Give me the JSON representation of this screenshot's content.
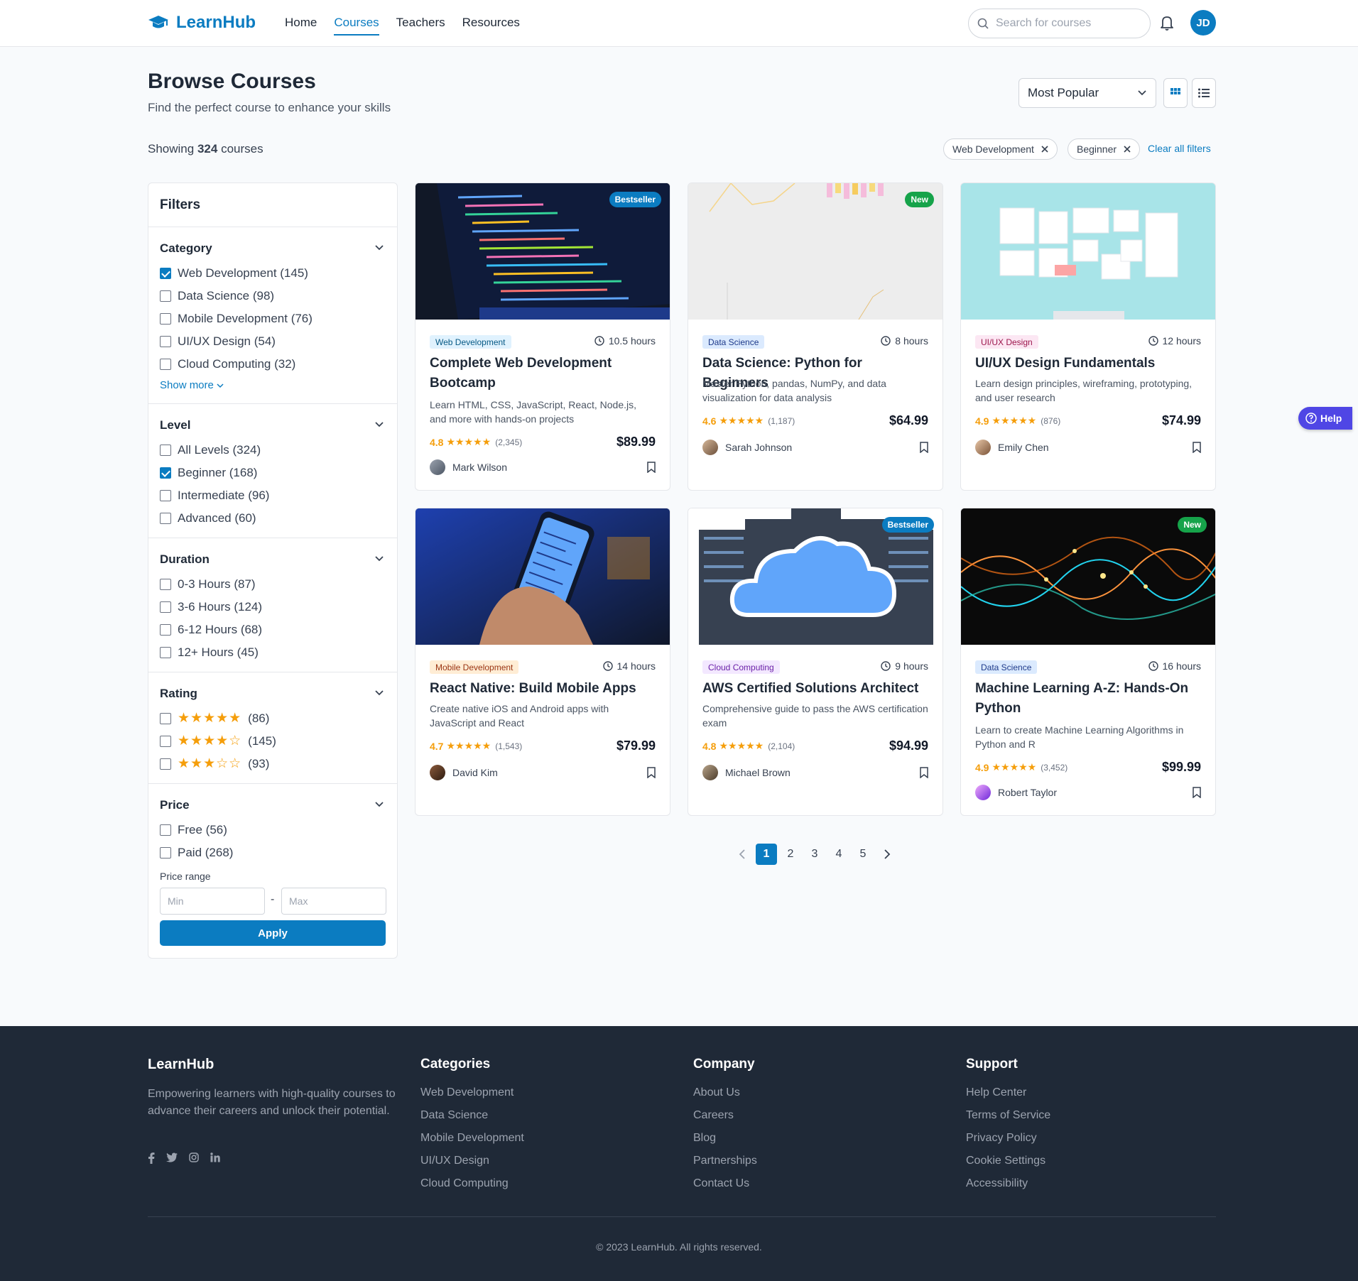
{
  "header": {
    "brand": "LearnHub",
    "nav": [
      "Home",
      "Courses",
      "Teachers",
      "Resources"
    ],
    "active_nav": "Courses",
    "search_placeholder": "Search for courses",
    "user_initials": "JD"
  },
  "page": {
    "title": "Browse Courses",
    "subtitle": "Find the perfect course to enhance your skills",
    "sort_value": "Most Popular",
    "showing_prefix": "Showing",
    "showing_count": "324",
    "showing_suffix": "courses",
    "active_filters": [
      "Web Development",
      "Beginner"
    ],
    "clear_filters": "Clear all filters"
  },
  "filters": {
    "title": "Filters",
    "category": {
      "title": "Category",
      "options": [
        {
          "label": "Web Development (145)",
          "checked": true
        },
        {
          "label": "Data Science (98)",
          "checked": false
        },
        {
          "label": "Mobile Development (76)",
          "checked": false
        },
        {
          "label": "UI/UX Design (54)",
          "checked": false
        },
        {
          "label": "Cloud Computing (32)",
          "checked": false
        }
      ],
      "show_more": "Show more"
    },
    "level": {
      "title": "Level",
      "options": [
        {
          "label": "All Levels (324)",
          "checked": false
        },
        {
          "label": "Beginner (168)",
          "checked": true
        },
        {
          "label": "Intermediate (96)",
          "checked": false
        },
        {
          "label": "Advanced (60)",
          "checked": false
        }
      ]
    },
    "duration": {
      "title": "Duration",
      "options": [
        {
          "label": "0-3 Hours (87)",
          "checked": false
        },
        {
          "label": "3-6 Hours (124)",
          "checked": false
        },
        {
          "label": "6-12 Hours (68)",
          "checked": false
        },
        {
          "label": "12+ Hours (45)",
          "checked": false
        }
      ]
    },
    "rating": {
      "title": "Rating",
      "options": [
        {
          "stars": "★★★★★",
          "count": "(86)",
          "checked": false
        },
        {
          "stars": "★★★★☆",
          "count": "(145)",
          "checked": false
        },
        {
          "stars": "★★★☆☆",
          "count": "(93)",
          "checked": false
        }
      ]
    },
    "price": {
      "title": "Price",
      "options": [
        {
          "label": "Free (56)",
          "checked": false
        },
        {
          "label": "Paid (268)",
          "checked": false
        }
      ],
      "range_label": "Price range",
      "min_placeholder": "Min",
      "max_placeholder": "Max",
      "apply": "Apply"
    }
  },
  "courses": [
    {
      "badge": "Bestseller",
      "category": "Web Development",
      "hours": "10.5 hours",
      "title": "Complete Web Development Bootcamp",
      "desc": "Learn HTML, CSS, JavaScript, React, Node.js, and more with hands-on projects",
      "rating": "4.8",
      "stars": "★★★★★",
      "reviews": "(2,345)",
      "price": "$89.99",
      "instructor": "Mark Wilson"
    },
    {
      "badge": "New",
      "category": "Data Science",
      "hours": "8 hours",
      "title": "Data Science: Python for Beginners",
      "desc": "Master Python, pandas, NumPy, and data visualization for data analysis",
      "rating": "4.6",
      "stars": "★★★★★",
      "reviews": "(1,187)",
      "price": "$64.99",
      "instructor": "Sarah Johnson"
    },
    {
      "badge": "",
      "category": "UI/UX Design",
      "hours": "12 hours",
      "title": "UI/UX Design Fundamentals",
      "desc": "Learn design principles, wireframing, prototyping, and user research",
      "rating": "4.9",
      "stars": "★★★★★",
      "reviews": "(876)",
      "price": "$74.99",
      "instructor": "Emily Chen"
    },
    {
      "badge": "",
      "category": "Mobile Development",
      "hours": "14 hours",
      "title": "React Native: Build Mobile Apps",
      "desc": "Create native iOS and Android apps with JavaScript and React",
      "rating": "4.7",
      "stars": "★★★★★",
      "reviews": "(1,543)",
      "price": "$79.99",
      "instructor": "David Kim"
    },
    {
      "badge": "Bestseller",
      "category": "Cloud Computing",
      "hours": "9 hours",
      "title": "AWS Certified Solutions Architect",
      "desc": "Comprehensive guide to pass the AWS certification exam",
      "rating": "4.8",
      "stars": "★★★★★",
      "reviews": "(2,104)",
      "price": "$94.99",
      "instructor": "Michael Brown"
    },
    {
      "badge": "New",
      "category": "Data Science",
      "hours": "16 hours",
      "title": "Machine Learning A-Z: Hands-On Python",
      "desc": "Learn to create Machine Learning Algorithms in Python and R",
      "rating": "4.9",
      "stars": "★★★★★",
      "reviews": "(3,452)",
      "price": "$99.99",
      "instructor": "Robert Taylor"
    }
  ],
  "pagination": {
    "pages": [
      "1",
      "2",
      "3",
      "4",
      "5"
    ],
    "current": "1"
  },
  "help": "Help",
  "footer": {
    "brand": "LearnHub",
    "about": "Empowering learners with high-quality courses to advance their careers and unlock their potential.",
    "social_icons": [
      "facebook-icon",
      "twitter-icon",
      "instagram-icon",
      "linkedin-icon"
    ],
    "columns": [
      {
        "title": "Categories",
        "links": [
          "Web Development",
          "Data Science",
          "Mobile Development",
          "UI/UX Design",
          "Cloud Computing"
        ]
      },
      {
        "title": "Company",
        "links": [
          "About Us",
          "Careers",
          "Blog",
          "Partnerships",
          "Contact Us"
        ]
      },
      {
        "title": "Support",
        "links": [
          "Help Center",
          "Terms of Service",
          "Privacy Policy",
          "Cookie Settings",
          "Accessibility"
        ]
      }
    ],
    "copyright": "© 2023 LearnHub. All rights reserved."
  },
  "colors": {
    "primary": "#0b7cc1",
    "star": "#f59e0b",
    "bestseller": "#0b7cc1",
    "new": "#16a34a",
    "help": "#4f46e5",
    "footer_bg": "#1f2937"
  }
}
